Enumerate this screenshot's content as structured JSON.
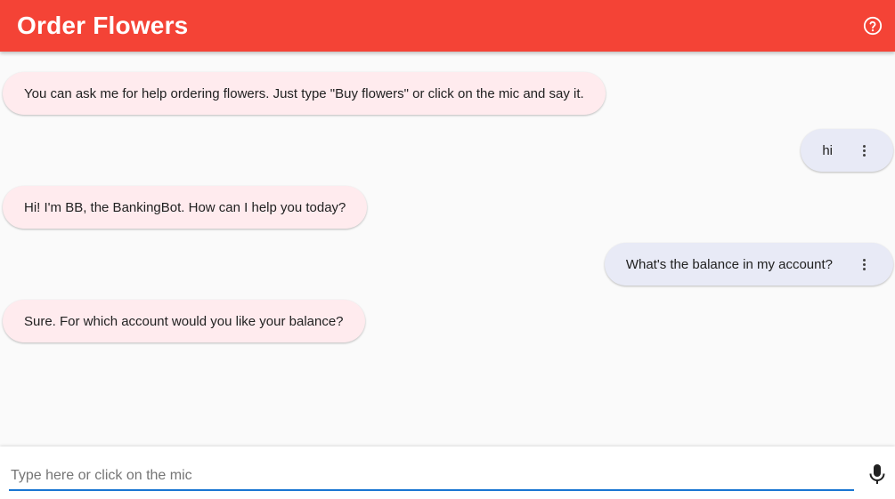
{
  "header": {
    "title": "Order Flowers",
    "help_icon": "help-circle-icon",
    "color": "#f44336"
  },
  "messages": [
    {
      "sender": "bot",
      "text": "You can ask me for help ordering flowers. Just type \"Buy flowers\" or click on the mic and say it."
    },
    {
      "sender": "user",
      "text": "hi"
    },
    {
      "sender": "bot",
      "text": "Hi! I'm BB, the BankingBot. How can I help you today?"
    },
    {
      "sender": "user",
      "text": "What's the balance in my account?"
    },
    {
      "sender": "bot",
      "text": "Sure. For which account would you like your balance?"
    }
  ],
  "input": {
    "value": "",
    "placeholder": "Type here or click on the mic",
    "mic_icon": "microphone-icon"
  },
  "colors": {
    "bot_bubble": "#ffebee",
    "user_bubble": "#e8eaf6",
    "input_underline": "#1976d2"
  }
}
